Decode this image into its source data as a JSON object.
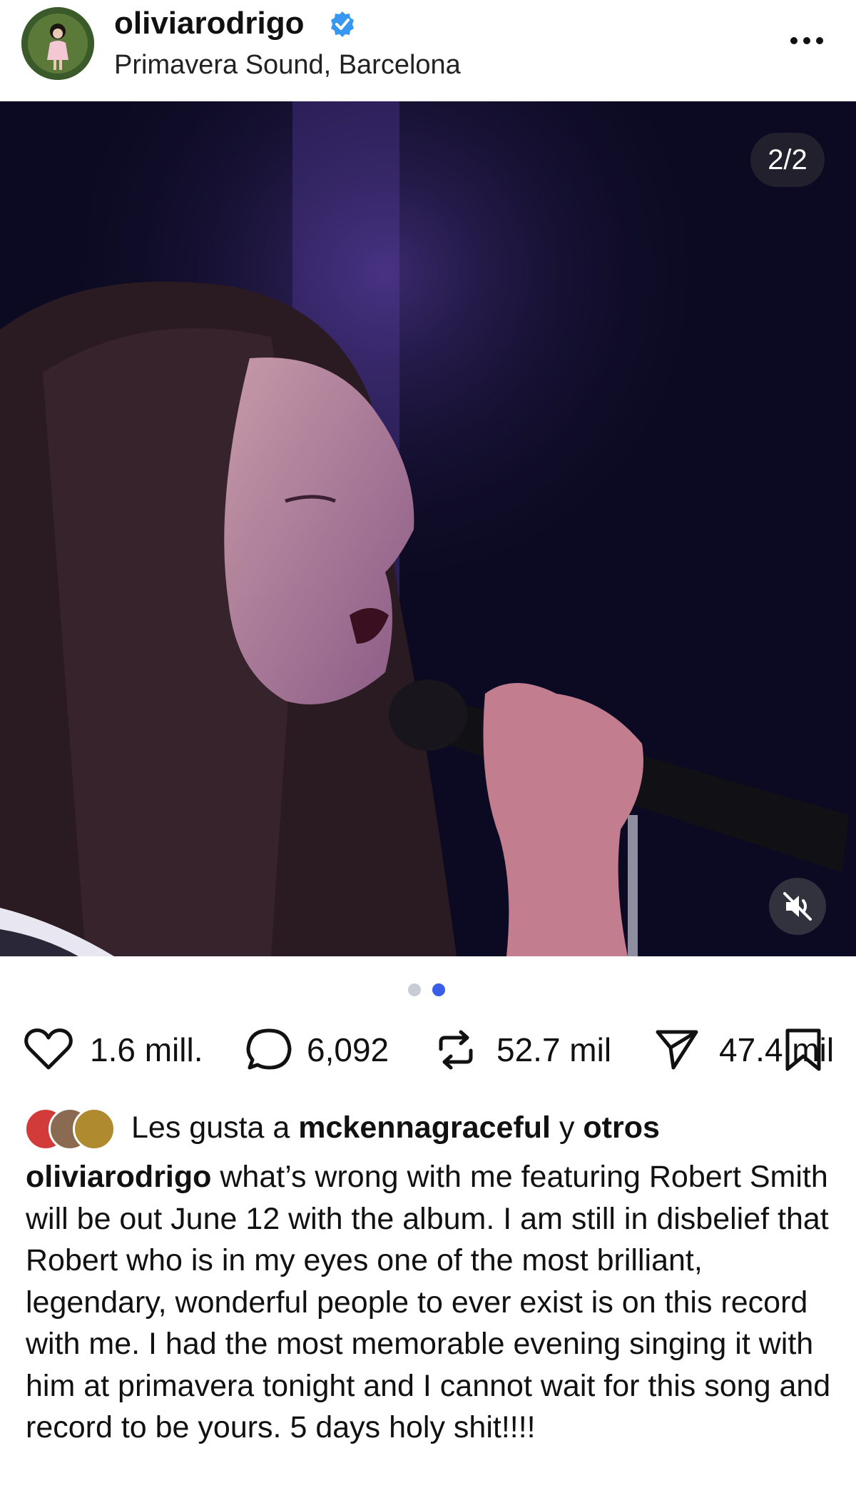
{
  "header": {
    "username": "oliviarodrigo",
    "location": "Primavera Sound, Barcelona",
    "more_label": "..."
  },
  "media": {
    "counter": "2/2",
    "active_index": 2,
    "total": 2
  },
  "actions": {
    "likes": "1.6 mill.",
    "comments": "6,092",
    "reposts": "52.7 mil",
    "shares": "47.4 mil"
  },
  "liked_by": {
    "prefix": "Les gusta a",
    "user": "mckennagraceful",
    "connector": "y",
    "others": "otros"
  },
  "caption": {
    "username": "oliviarodrigo",
    "text": "what’s wrong with me featuring Robert Smith will be out June 12 with the album. I am still in disbelief that Robert who is in my eyes one of the most brilliant, legendary, wonderful people to ever exist is on this record with me. I had the most memorable evening singing it with him at primavera tonight and I cannot wait for this song and record to be yours. 5 days holy shit!!!!"
  },
  "colors": {
    "verified": "#3897f0",
    "dot_active": "#3b5ee8",
    "dot_inactive": "#c8ccd4"
  }
}
